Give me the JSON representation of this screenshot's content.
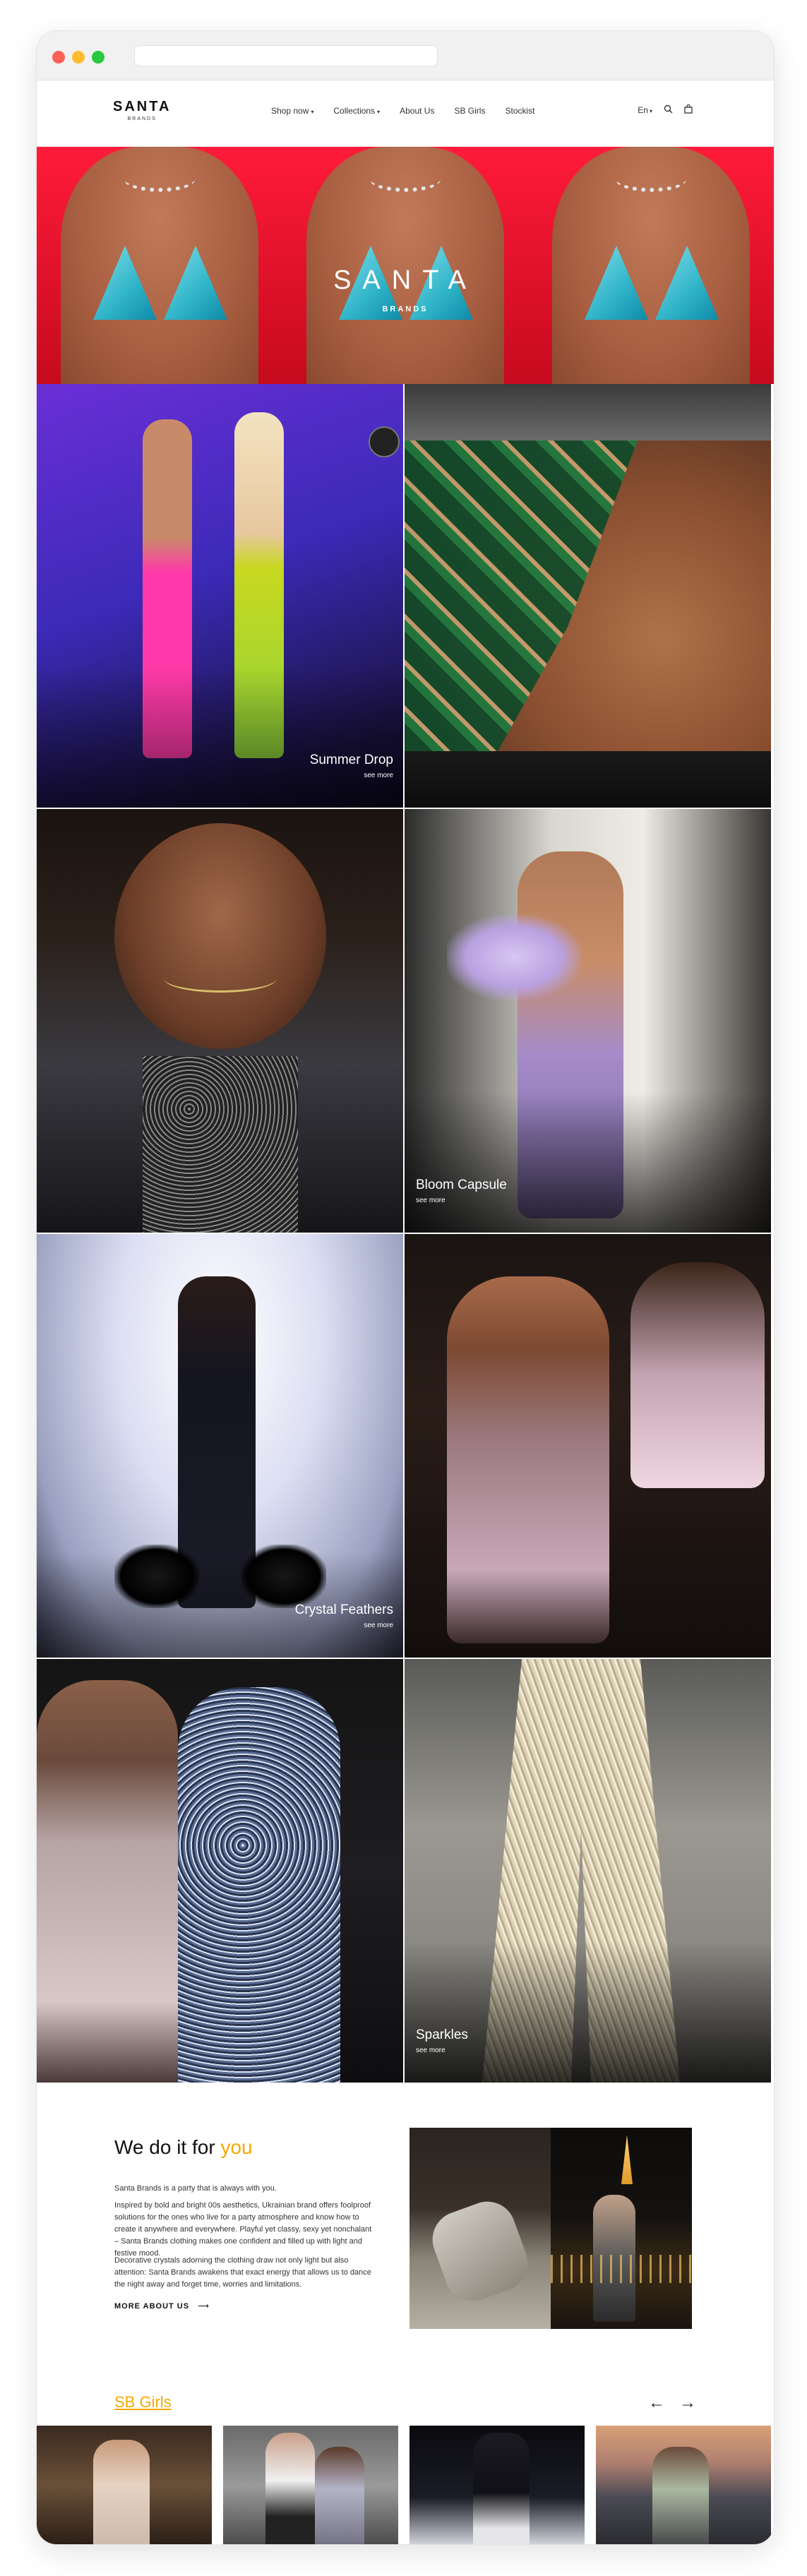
{
  "header": {
    "logo_main": "SANTA",
    "logo_sub": "BRANDS",
    "menu": [
      "Shop now",
      "Collections",
      "About Us",
      "SB Girls",
      "Stockist"
    ],
    "language": "En"
  },
  "hero": {
    "title": "SANTA",
    "subtitle": "BRANDS"
  },
  "collections": [
    {
      "label": "Summer Drop",
      "more": "see more"
    },
    {
      "label": "Bloom Capsule",
      "more": "see more"
    },
    {
      "label": "Crystal Feathers",
      "more": "see more"
    },
    {
      "label": "Sparkles",
      "more": "see more"
    }
  ],
  "about": {
    "heading_main": "We do it for",
    "heading_accent": "you",
    "p1": "Santa Brands is a party that is always with you.",
    "p2": "Inspired by bold and bright 00s aesthetics, Ukrainian brand offers foolproof solutions for the ones who live for a party atmosphere and know how to create it anywhere and everywhere. Playful yet classy, sexy yet nonchalant – Santa Brands clothing makes one confident and filled up with light and festive mood.",
    "p3": "Decorative crystals adorning the clothing draw not only light but also attention: Santa Brands awakens that exact energy that allows us to dance the night away and forget time, worries and limitations.",
    "link": "MORE ABOUT US"
  },
  "girls": {
    "title": "SB Girls",
    "prev": "←",
    "next": "→"
  },
  "icons": {
    "search": "search-icon",
    "cart": "cart-icon",
    "arrow": "arrow-right-icon"
  },
  "colors": {
    "accent": "#f2a900",
    "hero_red": "#e01428"
  }
}
